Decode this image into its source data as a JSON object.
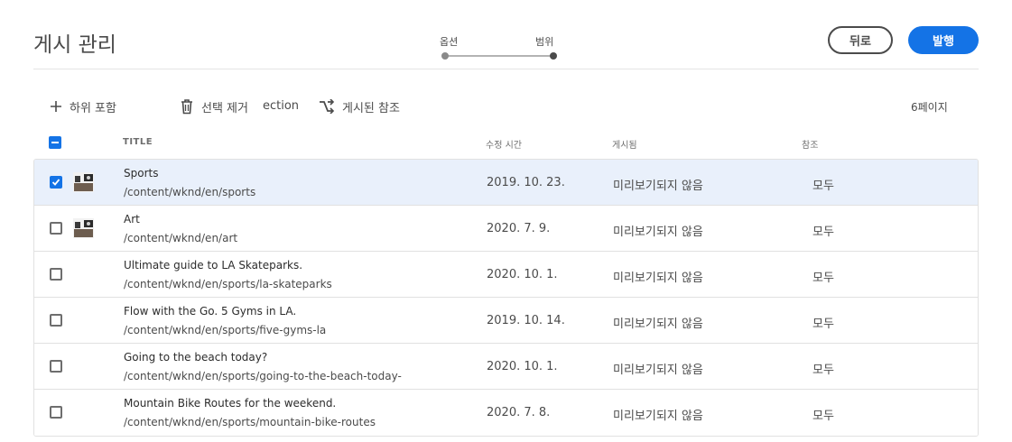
{
  "header": {
    "title": "게시 관리",
    "steps": [
      "옵션",
      "범위"
    ],
    "back_label": "뒤로",
    "publish_label": "발행"
  },
  "toolbar": {
    "include_children_label": "하위 포함",
    "remove_selection_label": "선택 제거",
    "remove_selection_suffix": "ection",
    "published_refs_label": "게시된 참조",
    "page_count": "6페이지"
  },
  "table": {
    "columns": {
      "title": "TITLE",
      "modified": "수정 시간",
      "published": "게시됨",
      "references": "참조"
    },
    "rows": [
      {
        "title": "Sports",
        "path": "/content/wknd/en/sports",
        "modified": "2019. 10. 23.",
        "published": "미리보기되지 않음",
        "references": "모두",
        "selected": true,
        "thumbnail": true
      },
      {
        "title": "Art",
        "path": "/content/wknd/en/art",
        "modified": "2020. 7. 9.",
        "published": "미리보기되지 않음",
        "references": "모두",
        "selected": false,
        "thumbnail": true
      },
      {
        "title": "Ultimate guide to LA Skateparks.",
        "path": "/content/wknd/en/sports/la-skateparks",
        "modified": "2020. 10. 1.",
        "published": "미리보기되지 않음",
        "references": "모두",
        "selected": false,
        "thumbnail": false
      },
      {
        "title": "Flow with the Go. 5 Gyms in LA.",
        "path": "/content/wknd/en/sports/five-gyms-la",
        "modified": "2019. 10. 14.",
        "published": "미리보기되지 않음",
        "references": "모두",
        "selected": false,
        "thumbnail": false
      },
      {
        "title": "Going to the beach today?",
        "path": "/content/wknd/en/sports/going-to-the-beach-today-",
        "modified": "2020. 10. 1.",
        "published": "미리보기되지 않음",
        "references": "모두",
        "selected": false,
        "thumbnail": false
      },
      {
        "title": "Mountain Bike Routes for the weekend.",
        "path": "/content/wknd/en/sports/mountain-bike-routes",
        "modified": "2020. 7. 8.",
        "published": "미리보기되지 않음",
        "references": "모두",
        "selected": false,
        "thumbnail": false
      }
    ]
  },
  "colors": {
    "accent": "#1473e6",
    "selected_row": "#e9f0fb"
  }
}
